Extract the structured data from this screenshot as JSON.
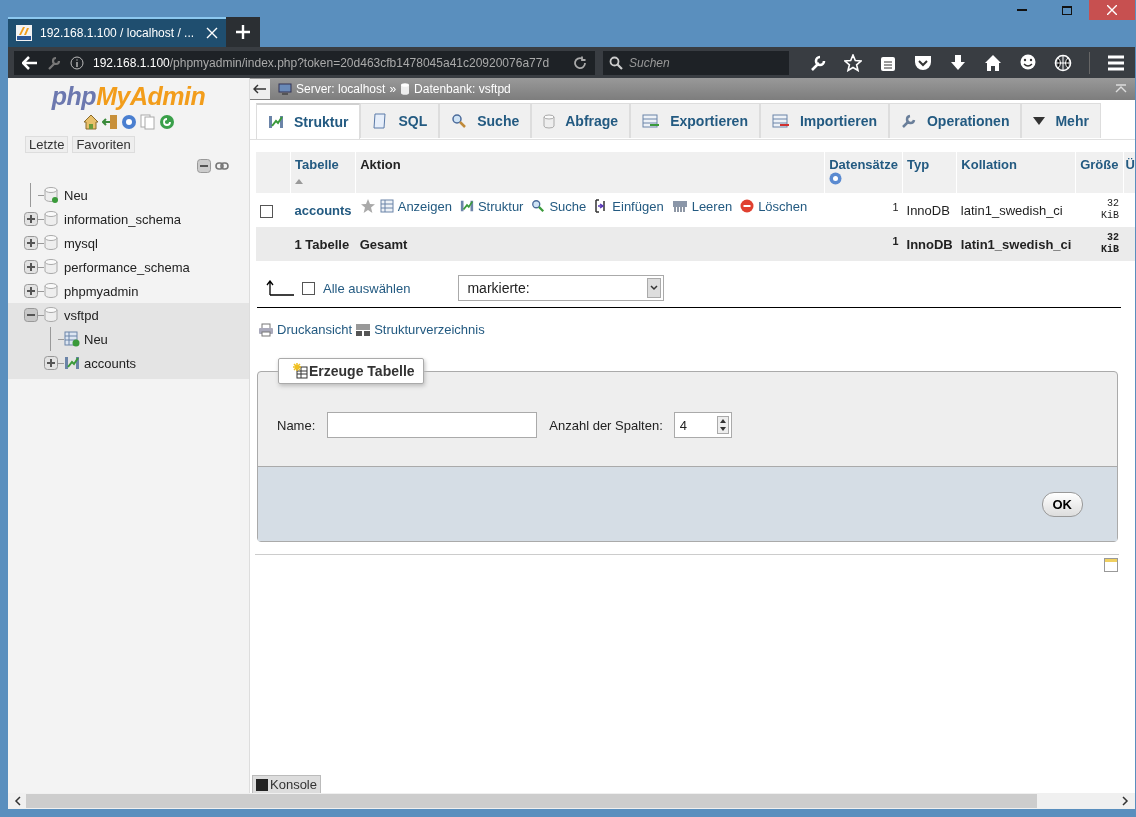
{
  "browser": {
    "tab_title": "192.168.1.100 / localhost / ...",
    "url_host": "192.168.1.100",
    "url_path": "/phpmyadmin/index.php?token=20d463cfb1478045a41c20920076a77d",
    "search_placeholder": "Suchen"
  },
  "sidebar": {
    "logo_php": "php",
    "logo_rest": "MyAdmin",
    "buttons": [
      "Letzte",
      "Favoriten"
    ],
    "tree": [
      {
        "label": "Neu",
        "kind": "new"
      },
      {
        "label": "information_schema",
        "kind": "db",
        "expanded": false,
        "selected": false
      },
      {
        "label": "mysql",
        "kind": "db",
        "expanded": false,
        "selected": false
      },
      {
        "label": "performance_schema",
        "kind": "db",
        "expanded": false,
        "selected": false
      },
      {
        "label": "phpmyadmin",
        "kind": "db",
        "expanded": false,
        "selected": false
      },
      {
        "label": "vsftpd",
        "kind": "db",
        "expanded": true,
        "selected": true,
        "children": [
          {
            "label": "Neu",
            "kind": "new-table"
          },
          {
            "label": "accounts",
            "kind": "table",
            "expanded": false
          }
        ]
      }
    ]
  },
  "breadcrumb": {
    "server": "Server: localhost",
    "separator": "»",
    "database": "Datenbank: vsftpd"
  },
  "tabs": [
    {
      "label": "Struktur",
      "selected": true
    },
    {
      "label": "SQL",
      "selected": false
    },
    {
      "label": "Suche",
      "selected": false
    },
    {
      "label": "Abfrage",
      "selected": false
    },
    {
      "label": "Exportieren",
      "selected": false
    },
    {
      "label": "Importieren",
      "selected": false
    },
    {
      "label": "Operationen",
      "selected": false
    },
    {
      "label": "Mehr",
      "selected": false
    }
  ],
  "table": {
    "columns": [
      "Tabelle",
      "Aktion",
      "Datensätze",
      "Typ",
      "Kollation",
      "Größe",
      "Ü"
    ],
    "rows": [
      {
        "checked": false,
        "name": "accounts",
        "actions": [
          "Anzeigen",
          "Struktur",
          "Suche",
          "Einfügen",
          "Leeren",
          "Löschen"
        ],
        "records": "1",
        "type": "InnoDB",
        "collation": "latin1_swedish_ci",
        "size": "32 KiB"
      }
    ],
    "footer": {
      "name": "1 Tabelle",
      "action": "Gesamt",
      "records": "1",
      "type": "InnoDB",
      "collation": "latin1_swedish_ci",
      "size": "32 KiB"
    }
  },
  "select_all": {
    "label": "Alle auswählen",
    "checked": false,
    "dropdown": "markierte:"
  },
  "links": [
    "Druckansicht",
    "Strukturverzeichnis"
  ],
  "create_table": {
    "legend": "Erzeuge Tabelle",
    "name_label": "Name:",
    "columns_label": "Anzahl der Spalten:",
    "columns_value": "4",
    "ok": "OK"
  },
  "console": "Konsole"
}
